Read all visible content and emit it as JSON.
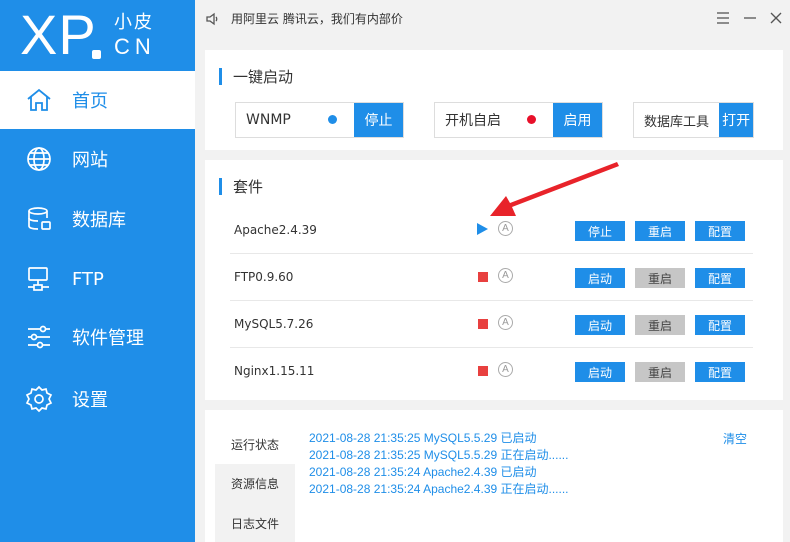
{
  "logo": {
    "xp": "XP",
    "cn_top": "小皮",
    "cn_bottom": "CN"
  },
  "sidebar": {
    "items": [
      {
        "label": "首页",
        "icon": "home-icon",
        "active": true
      },
      {
        "label": "网站",
        "icon": "globe-icon"
      },
      {
        "label": "数据库",
        "icon": "database-icon"
      },
      {
        "label": "FTP",
        "icon": "ftp-server-icon"
      },
      {
        "label": "软件管理",
        "icon": "sliders-icon"
      },
      {
        "label": "设置",
        "icon": "gear-icon"
      }
    ]
  },
  "topbar": {
    "notice": "用阿里云 腾讯云，我们有内部价",
    "icons": [
      "speaker-icon",
      "menu-icon",
      "minimize-icon",
      "close-icon"
    ]
  },
  "quick_start": {
    "title": "一键启动",
    "boxes": [
      {
        "label": "WNMP",
        "dot_color": "#1f8ee8",
        "button": "停止"
      },
      {
        "label": "开机自启",
        "dot_color": "#e8102a",
        "button": "启用"
      },
      {
        "label": "数据库工具",
        "button": "打开"
      }
    ]
  },
  "suites": {
    "title": "套件",
    "rows": [
      {
        "name": "Apache2.4.39",
        "status": "running",
        "auto": "A",
        "btn1": "停止",
        "btn2": "重启",
        "btn3": "配置"
      },
      {
        "name": "FTP0.9.60",
        "status": "stopped",
        "auto": "A",
        "btn1": "启动",
        "btn2": "重启",
        "btn3": "配置"
      },
      {
        "name": "MySQL5.7.26",
        "status": "stopped",
        "auto": "A",
        "btn1": "启动",
        "btn2": "重启",
        "btn3": "配置"
      },
      {
        "name": "Nginx1.15.11",
        "status": "stopped",
        "auto": "A",
        "btn1": "启动",
        "btn2": "重启",
        "btn3": "配置"
      }
    ]
  },
  "log": {
    "tabs": [
      "运行状态",
      "资源信息",
      "日志文件"
    ],
    "lines": [
      "2021-08-28 21:35:25 MySQL5.5.29 已启动",
      "2021-08-28 21:35:25 MySQL5.5.29 正在启动......",
      "2021-08-28 21:35:24 Apache2.4.39 已启动",
      "2021-08-28 21:35:24 Apache2.4.39 正在启动......"
    ],
    "clear_label": "清空"
  },
  "colors": {
    "accent": "#1f8ee8",
    "stopped": "#e8403f",
    "annotation_arrow": "#e8232a"
  }
}
